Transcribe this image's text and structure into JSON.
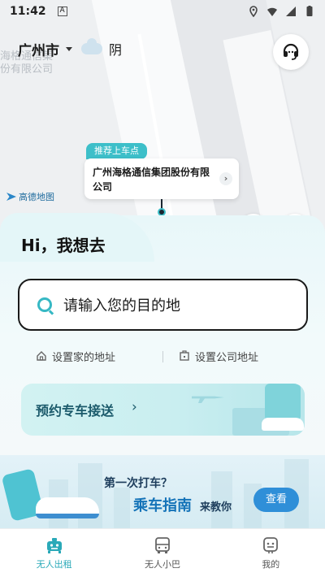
{
  "status_bar": {
    "time": "11:42",
    "notification_letter": "A",
    "icons": [
      "location-icon",
      "wifi-icon",
      "signal-icon",
      "battery-icon"
    ]
  },
  "header": {
    "city": "广州市",
    "weather": "阴",
    "weather_icon": "cloud-icon",
    "service_icon": "customer-service-icon"
  },
  "map": {
    "faded_place_label": [
      "海格通信集",
      "份有限公司"
    ],
    "pickup_tag": "推荐上车点",
    "pickup_name": "广州海格通信集团股份有限公司",
    "map_provider": "高德地图",
    "clock_icon": "clock-icon",
    "locate_icon": "locate-icon"
  },
  "main": {
    "greeting": "Hi，我想去",
    "search_placeholder": "请输入您的目的地",
    "set_home": "设置家的地址",
    "set_company": "设置公司地址",
    "promo_label": "预约专车接送",
    "promo_chevron": "›"
  },
  "banner": {
    "question": "第一次打车？",
    "title": "乘车指南",
    "subtitle": "来教你",
    "button": "查看"
  },
  "tabs": [
    {
      "label": "无人出租",
      "icon": "robotaxi-icon",
      "active": true
    },
    {
      "label": "无人小巴",
      "icon": "minibus-icon",
      "active": false
    },
    {
      "label": "我的",
      "icon": "profile-icon",
      "active": false
    }
  ],
  "colors": {
    "accent": "#2aa9b8",
    "pickup_tag": "#3dbfc9",
    "banner_button": "#2f8fd8"
  }
}
